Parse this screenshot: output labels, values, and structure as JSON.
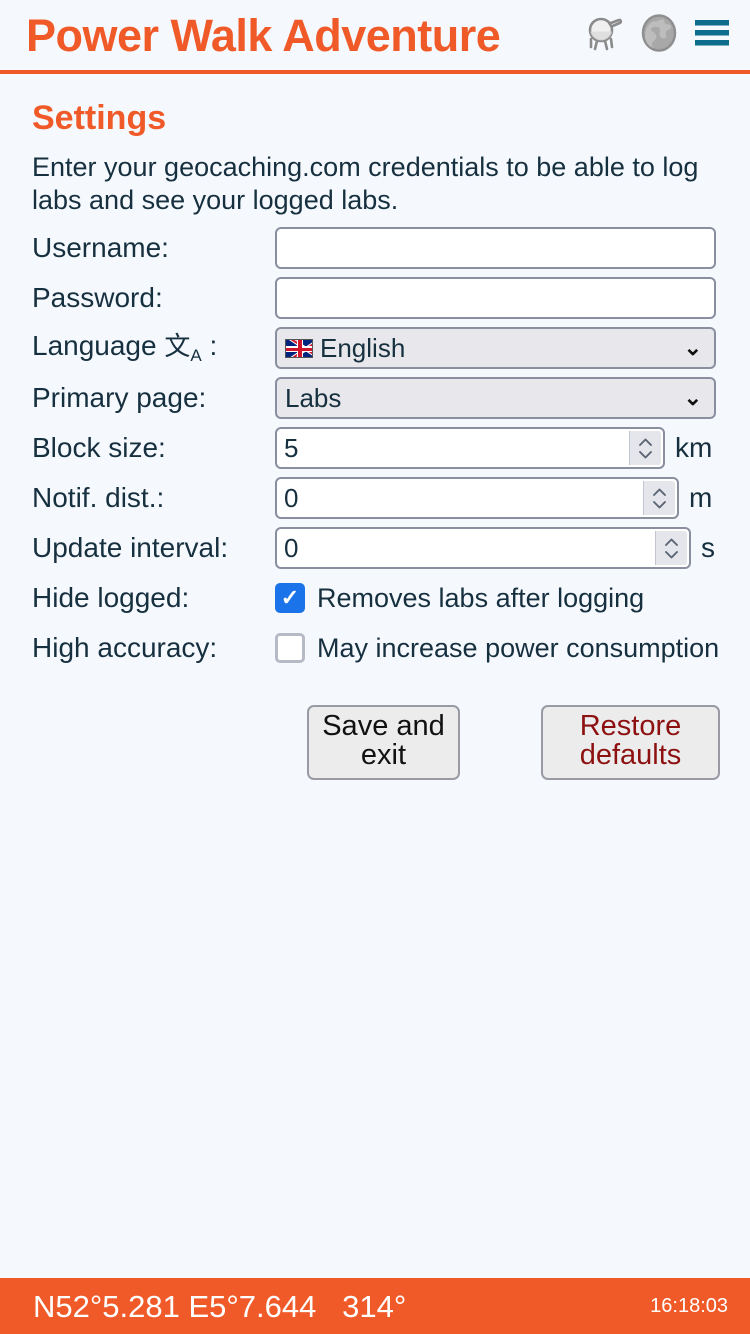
{
  "header": {
    "title": "Power Walk Adventure",
    "icons": [
      {
        "name": "lab-cache-icon",
        "label": "Labs"
      },
      {
        "name": "globe-icon",
        "label": "Map"
      },
      {
        "name": "hamburger-menu-icon",
        "label": "Menu"
      }
    ],
    "accent_color": "#f05a28",
    "menu_color": "#0c6e8c"
  },
  "page": {
    "title": "Settings",
    "intro": "Enter your geocaching.com credentials to be able to log labs and see your logged labs."
  },
  "form": {
    "username": {
      "label": "Username:",
      "value": "",
      "placeholder": ""
    },
    "password": {
      "label": "Password:",
      "value": "",
      "placeholder": ""
    },
    "language": {
      "label": "Language",
      "suffix": ":",
      "icon": "translate-icon",
      "value": "English",
      "flag": "uk-flag-icon"
    },
    "primary_page": {
      "label": "Primary page:",
      "value": "Labs"
    },
    "block_size": {
      "label": "Block size:",
      "value": "5",
      "unit": "km"
    },
    "notif_dist": {
      "label": "Notif. dist.:",
      "value": "0",
      "unit": "m"
    },
    "update_interval": {
      "label": "Update interval:",
      "value": "0",
      "unit": "s"
    },
    "hide_logged": {
      "label": "Hide logged:",
      "checked": true,
      "description": "Removes labs after logging"
    },
    "high_accuracy": {
      "label": "High accuracy:",
      "checked": false,
      "description": "May increase power consumption"
    }
  },
  "buttons": {
    "save_exit": "Save and exit",
    "restore_defaults": "Restore defaults",
    "restore_color": "#8d1111"
  },
  "footer": {
    "coordinates": "N52°5.281 E5°7.644   314°",
    "time": "16:18:03",
    "background_color": "#f05a28"
  }
}
